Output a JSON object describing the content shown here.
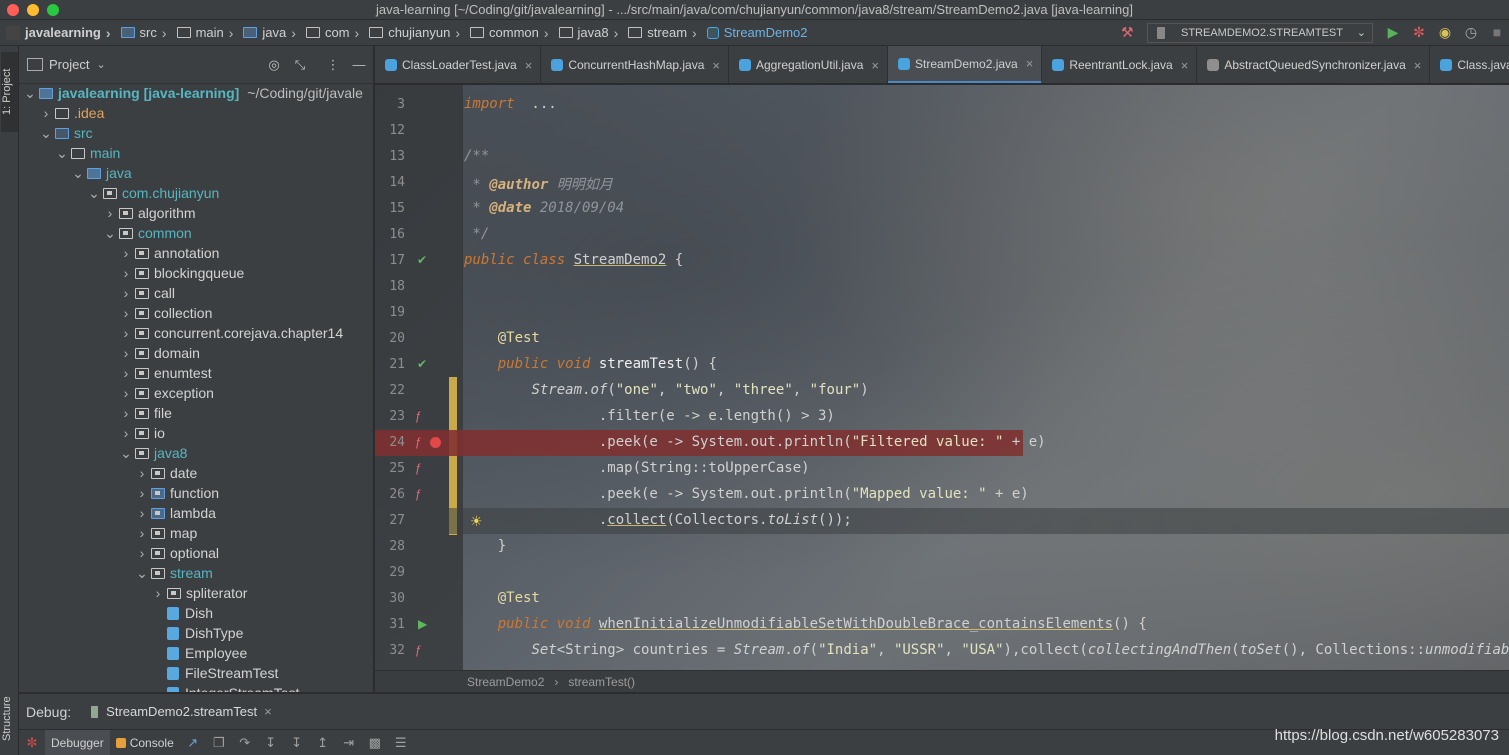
{
  "window": {
    "title": "java-learning [~/Coding/git/javalearning] - .../src/main/java/com/chujianyun/common/java8/stream/StreamDemo2.java [java-learning]"
  },
  "navbar": {
    "crumbs": [
      "javalearning",
      "src",
      "main",
      "java",
      "com",
      "chujianyun",
      "common",
      "java8",
      "stream",
      "StreamDemo2"
    ],
    "run_config": "STREAMDEMO2.STREAMTEST"
  },
  "left_strip": {
    "project_tab": "1: Project",
    "structure_tab": "Structure"
  },
  "project_panel": {
    "title": "Project",
    "tree": [
      {
        "label": "javalearning [java-learning]",
        "path": "~/Coding/git/javale",
        "depth": 0,
        "expanded": true,
        "kind": "module"
      },
      {
        "label": ".idea",
        "depth": 1,
        "expanded": false,
        "kind": "folder"
      },
      {
        "label": "src",
        "depth": 1,
        "expanded": true,
        "kind": "src"
      },
      {
        "label": "main",
        "depth": 2,
        "expanded": true,
        "kind": "folder"
      },
      {
        "label": "java",
        "depth": 3,
        "expanded": true,
        "kind": "source-root"
      },
      {
        "label": "com.chujianyun",
        "depth": 4,
        "expanded": true,
        "kind": "package"
      },
      {
        "label": "algorithm",
        "depth": 5,
        "expanded": false,
        "kind": "package"
      },
      {
        "label": "common",
        "depth": 5,
        "expanded": true,
        "kind": "package"
      },
      {
        "label": "annotation",
        "depth": 6,
        "expanded": false,
        "kind": "package"
      },
      {
        "label": "blockingqueue",
        "depth": 6,
        "expanded": false,
        "kind": "package"
      },
      {
        "label": "call",
        "depth": 6,
        "expanded": false,
        "kind": "package"
      },
      {
        "label": "collection",
        "depth": 6,
        "expanded": false,
        "kind": "package"
      },
      {
        "label": "concurrent.corejava.chapter14",
        "depth": 6,
        "expanded": false,
        "kind": "package"
      },
      {
        "label": "domain",
        "depth": 6,
        "expanded": false,
        "kind": "package"
      },
      {
        "label": "enumtest",
        "depth": 6,
        "expanded": false,
        "kind": "package"
      },
      {
        "label": "exception",
        "depth": 6,
        "expanded": false,
        "kind": "package"
      },
      {
        "label": "file",
        "depth": 6,
        "expanded": false,
        "kind": "package"
      },
      {
        "label": "io",
        "depth": 6,
        "expanded": false,
        "kind": "package"
      },
      {
        "label": "java8",
        "depth": 6,
        "expanded": true,
        "kind": "package"
      },
      {
        "label": "date",
        "depth": 7,
        "expanded": false,
        "kind": "package"
      },
      {
        "label": "function",
        "depth": 7,
        "expanded": false,
        "kind": "package-special"
      },
      {
        "label": "lambda",
        "depth": 7,
        "expanded": false,
        "kind": "package-special"
      },
      {
        "label": "map",
        "depth": 7,
        "expanded": false,
        "kind": "package"
      },
      {
        "label": "optional",
        "depth": 7,
        "expanded": false,
        "kind": "package"
      },
      {
        "label": "stream",
        "depth": 7,
        "expanded": true,
        "kind": "package"
      },
      {
        "label": "spliterator",
        "depth": 8,
        "expanded": false,
        "kind": "package"
      },
      {
        "label": "Dish",
        "depth": 8,
        "kind": "class"
      },
      {
        "label": "DishType",
        "depth": 8,
        "kind": "class"
      },
      {
        "label": "Employee",
        "depth": 8,
        "kind": "class"
      },
      {
        "label": "FileStreamTest",
        "depth": 8,
        "kind": "class"
      },
      {
        "label": "IntegerStreamTest",
        "depth": 8,
        "kind": "class"
      }
    ]
  },
  "editor": {
    "tabs": [
      {
        "label": "ClassLoaderTest.java",
        "active": false,
        "abstract": false
      },
      {
        "label": "ConcurrentHashMap.java",
        "active": false,
        "abstract": false
      },
      {
        "label": "AggregationUtil.java",
        "active": false,
        "abstract": false
      },
      {
        "label": "StreamDemo2.java",
        "active": true,
        "abstract": false
      },
      {
        "label": "ReentrantLock.java",
        "active": false,
        "abstract": false
      },
      {
        "label": "AbstractQueuedSynchronizer.java",
        "active": false,
        "abstract": true
      },
      {
        "label": "Class.java",
        "active": false,
        "abstract": false
      }
    ],
    "lines": [
      {
        "num": "3",
        "tokens": [
          [
            "kw",
            "import"
          ],
          [
            "",
            "  ..."
          ]
        ]
      },
      {
        "num": "12",
        "tokens": []
      },
      {
        "num": "13",
        "tokens": [
          [
            "cmt",
            "/**"
          ]
        ]
      },
      {
        "num": "14",
        "tokens": [
          [
            "cmt",
            " * "
          ],
          [
            "tag",
            "@author"
          ],
          [
            "cmt",
            " 明明如月"
          ]
        ]
      },
      {
        "num": "15",
        "tokens": [
          [
            "cmt",
            " * "
          ],
          [
            "tag",
            "@date"
          ],
          [
            "cmt",
            " 2018/09/04"
          ]
        ]
      },
      {
        "num": "16",
        "tokens": [
          [
            "cmt",
            " */"
          ]
        ]
      },
      {
        "num": "17",
        "tokens": [
          [
            "kw",
            "public"
          ],
          [
            "",
            " "
          ],
          [
            "kw",
            "class"
          ],
          [
            "",
            " "
          ],
          [
            "und",
            "StreamDemo2"
          ],
          [
            "",
            " {"
          ]
        ],
        "gutter": "test-pass"
      },
      {
        "num": "18",
        "tokens": []
      },
      {
        "num": "19",
        "tokens": []
      },
      {
        "num": "20",
        "tokens": [
          [
            "",
            "    "
          ],
          [
            "ann",
            "@Test"
          ]
        ]
      },
      {
        "num": "21",
        "tokens": [
          [
            "",
            "    "
          ],
          [
            "kw",
            "public"
          ],
          [
            "",
            " "
          ],
          [
            "kw",
            "void"
          ],
          [
            "",
            " "
          ],
          [
            "fn",
            "streamTest"
          ],
          [
            "",
            "() {"
          ]
        ],
        "gutter": "test-pass"
      },
      {
        "num": "22",
        "tokens": [
          [
            "",
            "        "
          ],
          [
            "ital",
            "Stream"
          ],
          [
            "",
            "."
          ],
          [
            "ital",
            "of"
          ],
          [
            "",
            "("
          ],
          [
            "str",
            "\"one\""
          ],
          [
            "",
            ", "
          ],
          [
            "str",
            "\"two\""
          ],
          [
            "",
            ", "
          ],
          [
            "str",
            "\"three\""
          ],
          [
            "",
            ", "
          ],
          [
            "str",
            "\"four\""
          ],
          [
            "",
            ")"
          ]
        ]
      },
      {
        "num": "23",
        "tokens": [
          [
            "",
            "                "
          ],
          [
            "",
            ".filter(e -> e.length() > 3)"
          ]
        ],
        "gutter": "lambda"
      },
      {
        "num": "24",
        "tokens": [
          [
            "",
            "                "
          ],
          [
            "",
            ".peek(e -> System.out.println("
          ],
          [
            "str",
            "\"Filtered value: \""
          ],
          [
            "",
            " + e)"
          ]
        ],
        "gutter": "lambda-breakpoint",
        "breakpoint": true
      },
      {
        "num": "25",
        "tokens": [
          [
            "",
            "                "
          ],
          [
            "",
            ".map(String::toUpperCase)"
          ]
        ],
        "gutter": "lambda"
      },
      {
        "num": "26",
        "tokens": [
          [
            "",
            "                "
          ],
          [
            "",
            ".peek(e -> System.out.println("
          ],
          [
            "str",
            "\"Mapped value: \""
          ],
          [
            "",
            " + e)"
          ]
        ],
        "gutter": "lambda"
      },
      {
        "num": "27",
        "tokens": [
          [
            "",
            "                "
          ],
          [
            "",
            "."
          ],
          [
            "und",
            "collect"
          ],
          [
            "",
            "(Collectors."
          ],
          [
            "ital",
            "toList"
          ],
          [
            "",
            "());"
          ]
        ],
        "gutter": "bulb",
        "current": true
      },
      {
        "num": "28",
        "tokens": [
          [
            "",
            "    }"
          ]
        ]
      },
      {
        "num": "29",
        "tokens": []
      },
      {
        "num": "30",
        "tokens": [
          [
            "",
            "    "
          ],
          [
            "ann",
            "@Test"
          ]
        ]
      },
      {
        "num": "31",
        "tokens": [
          [
            "",
            "    "
          ],
          [
            "kw",
            "public"
          ],
          [
            "",
            " "
          ],
          [
            "kw",
            "void"
          ],
          [
            "",
            " "
          ],
          [
            "und",
            "whenInitializeUnmodifiableSetWithDoubleBrace_containsElements"
          ],
          [
            "",
            "() {"
          ]
        ],
        "gutter": "run"
      },
      {
        "num": "32",
        "tokens": [
          [
            "",
            "        "
          ],
          [
            "ital",
            "Set"
          ],
          [
            "",
            "<String> countries = "
          ],
          [
            "ital",
            "Stream"
          ],
          [
            "",
            "."
          ],
          [
            "ital",
            "of"
          ],
          [
            "",
            "("
          ],
          [
            "str",
            "\"India\""
          ],
          [
            "",
            ", "
          ],
          [
            "str",
            "\"USSR\""
          ],
          [
            "",
            ", "
          ],
          [
            "str",
            "\"USA\""
          ],
          [
            "",
            "),collect("
          ],
          [
            "ital",
            "collectingAndThen"
          ],
          [
            "",
            "("
          ],
          [
            "ital",
            "toSet"
          ],
          [
            "",
            "(), Collections::"
          ],
          [
            "ital",
            "unmodifiableSet"
          ],
          [
            "",
            "));"
          ]
        ],
        "gutter": "lambda"
      }
    ],
    "breadcrumb": [
      "StreamDemo2",
      "streamTest()"
    ]
  },
  "debug": {
    "label": "Debug:",
    "session_tab": "StreamDemo2.streamTest",
    "debugger_tab": "Debugger",
    "console_tab": "Console"
  },
  "watermark": "https://blog.csdn.net/w605283073",
  "colors": {
    "accent": "#4a88c7",
    "breakpoint": "#e0484a",
    "change_marker": "#d9b64b",
    "test_pass": "#5fb85f"
  }
}
